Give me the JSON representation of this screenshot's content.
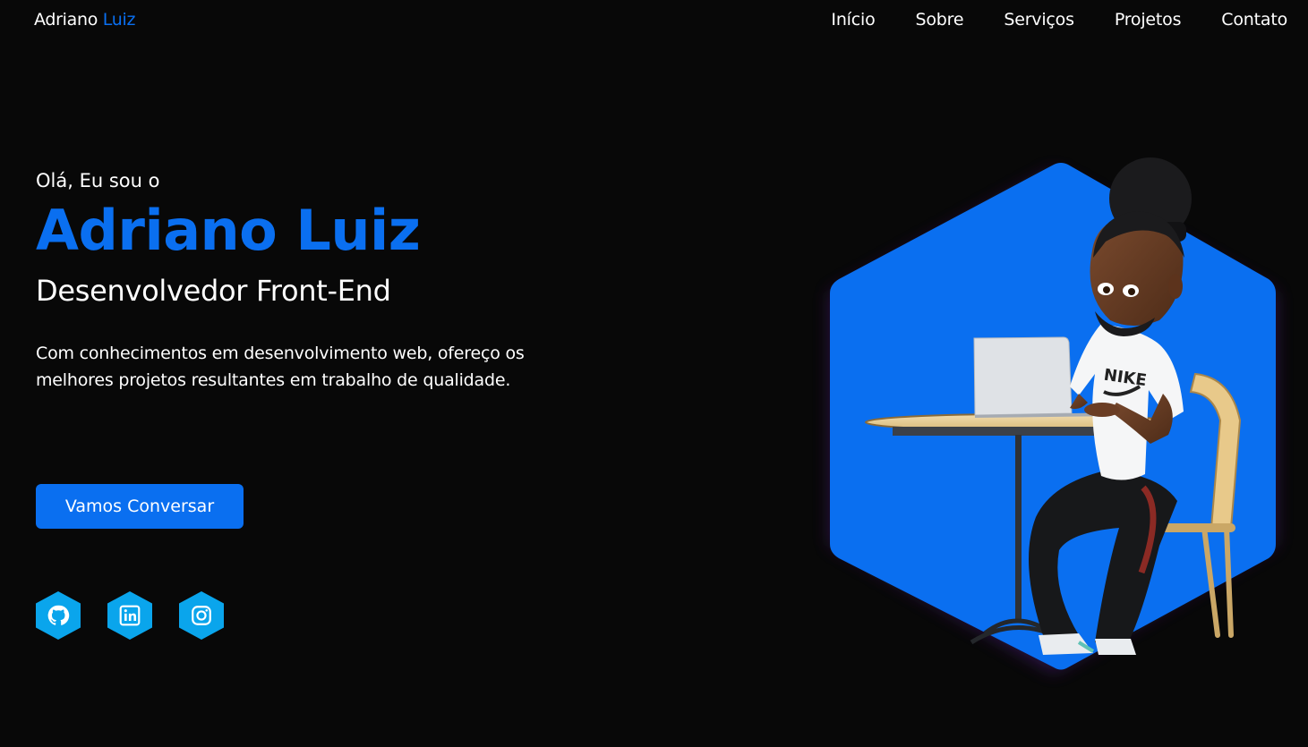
{
  "nav": {
    "logo_first": "Adriano",
    "logo_accent": "Luiz",
    "links": [
      "Início",
      "Sobre",
      "Serviços",
      "Projetos",
      "Contato"
    ]
  },
  "hero": {
    "greeting": "Olá, Eu sou o",
    "name": "Adriano Luiz",
    "role": "Desenvolvedor Front-End",
    "description": "Com conhecimentos em desenvolvimento web, ofereço os melhores projetos resultantes em trabalho de qualidade.",
    "cta_label": "Vamos Conversar"
  },
  "socials": [
    {
      "icon": "github-icon"
    },
    {
      "icon": "linkedin-icon"
    },
    {
      "icon": "instagram-icon"
    }
  ],
  "colors": {
    "background": "#080808",
    "accent": "#0a6ff0",
    "social_bg": "#0aa5ec"
  }
}
